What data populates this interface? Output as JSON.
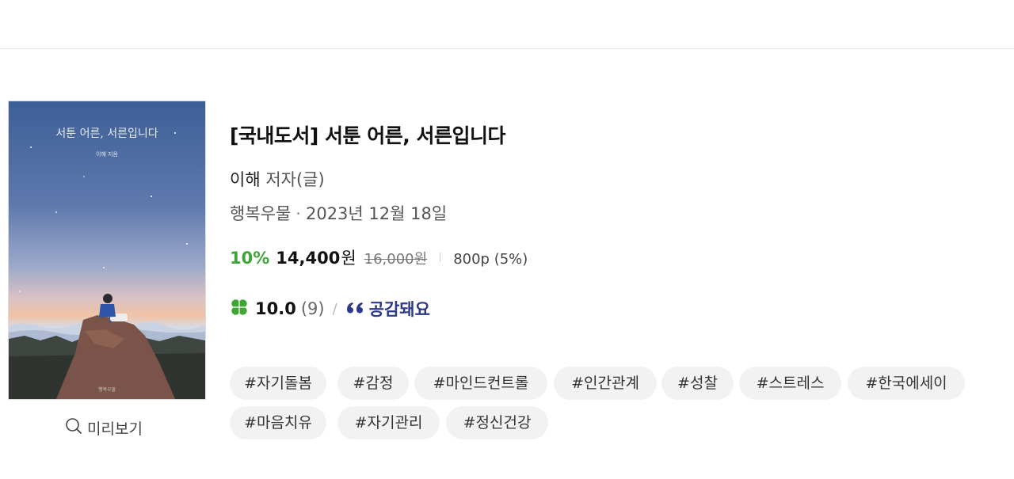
{
  "book": {
    "cover_title": "서툰 어른, 서른입니다",
    "cover_author": "이해 지음",
    "cover_publisher": "행복우물",
    "preview_label": "미리보기",
    "title": "[국내도서]  서툰 어른, 서른입니다",
    "author_name": "이해",
    "author_role": "저자(글)",
    "publisher": "행복우물",
    "separator": "·",
    "pub_date": "2023년 12월 18일",
    "discount": "10%",
    "price": "14,400",
    "price_unit": "원",
    "original_price": "16,000원",
    "points": "800p (5%)",
    "rating": "10.0",
    "review_count": "(9)",
    "rating_slash": "/",
    "empathy_label": "공감돼요",
    "tags": [
      "#자기돌봄",
      "#감정",
      "#마인드컨트롤",
      "#인간관계",
      "#성찰",
      "#스트레스",
      "#한국에세이",
      "#마음치유",
      "#자기관리",
      "#정신건강"
    ]
  },
  "icons": {
    "preview": "magnifier-icon",
    "rating": "clover-icon",
    "empathy": "quote-icon"
  },
  "colors": {
    "discount": "#3fa535",
    "empathy": "#2e3a88",
    "tag_bg": "#f2f2f2"
  }
}
